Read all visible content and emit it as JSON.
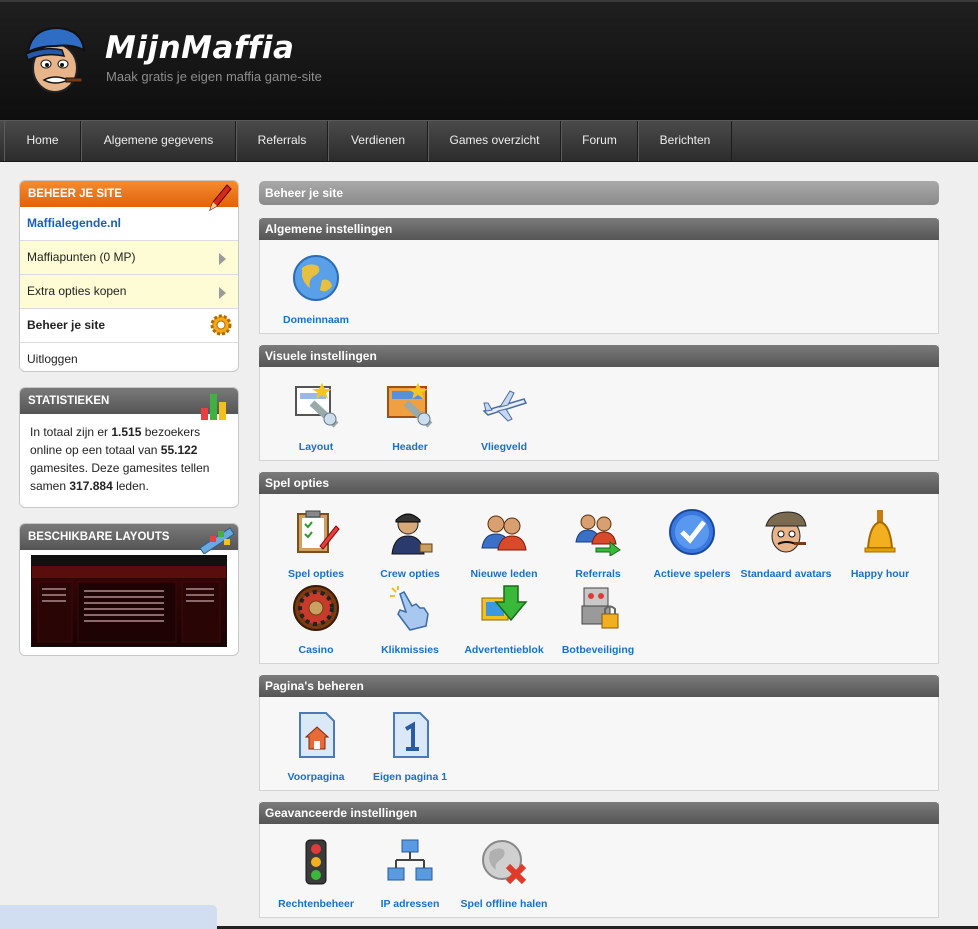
{
  "header": {
    "title": "MijnMaffia",
    "subtitle": "Maak gratis je eigen maffia game-site"
  },
  "nav": [
    "Home",
    "Algemene gegevens",
    "Referrals",
    "Verdienen",
    "Games overzicht",
    "Forum",
    "Berichten"
  ],
  "sidebar": {
    "manage": {
      "title": "BEHEER JE SITE",
      "site_link": "Maffialegende.nl",
      "items": [
        {
          "label": "Maffiapunten (0 MP)"
        },
        {
          "label": "Extra opties kopen"
        },
        {
          "label": "Beheer je site"
        },
        {
          "label": "Uitloggen"
        }
      ]
    },
    "stats": {
      "title": "STATISTIEKEN",
      "t1": "In totaal zijn er ",
      "visitors": "1.515",
      "t2": " bezoekers online op een totaal van ",
      "sites": "55.122",
      "t3": " gamesites. Deze gamesites tellen samen ",
      "members": "317.884",
      "t4": " leden."
    },
    "layouts": {
      "title": "BESCHIKBARE LAYOUTS"
    }
  },
  "main": {
    "title": "Beheer je site",
    "sections": [
      {
        "title": "Algemene instellingen",
        "items": [
          {
            "label": "Domeinnaam",
            "icon": "globe-icon"
          }
        ]
      },
      {
        "title": "Visuele instellingen",
        "items": [
          {
            "label": "Layout",
            "icon": "layout-icon"
          },
          {
            "label": "Header",
            "icon": "header-icon"
          },
          {
            "label": "Vliegveld",
            "icon": "airplane-icon"
          }
        ]
      },
      {
        "title": "Spel opties",
        "items": [
          {
            "label": "Spel opties",
            "icon": "clipboard-icon"
          },
          {
            "label": "Crew opties",
            "icon": "officer-icon"
          },
          {
            "label": "Nieuwe leden",
            "icon": "users-icon"
          },
          {
            "label": "Referrals",
            "icon": "users-arrow-icon"
          },
          {
            "label": "Actieve spelers",
            "icon": "checkmark-icon"
          },
          {
            "label": "Standaard avatars",
            "icon": "mobster-icon"
          },
          {
            "label": "Happy hour",
            "icon": "bell-icon"
          },
          {
            "label": "Casino",
            "icon": "roulette-icon"
          },
          {
            "label": "Klikmissies",
            "icon": "hand-click-icon"
          },
          {
            "label": "Advertentieblok",
            "icon": "advert-icon"
          },
          {
            "label": "Botbeveiliging",
            "icon": "robot-lock-icon"
          }
        ]
      },
      {
        "title": "Pagina's beheren",
        "items": [
          {
            "label": "Voorpagina",
            "icon": "home-page-icon"
          },
          {
            "label": "Eigen pagina 1",
            "icon": "page-one-icon"
          }
        ]
      },
      {
        "title": "Geavanceerde instellingen",
        "items": [
          {
            "label": "Rechtenbeheer",
            "icon": "traffic-light-icon"
          },
          {
            "label": "IP adressen",
            "icon": "network-icon"
          },
          {
            "label": "Spel offline halen",
            "icon": "globe-offline-icon"
          }
        ]
      }
    ]
  },
  "colors": {
    "accent_orange": "#e0630c",
    "link_blue": "#1a6fc9",
    "header_dark": "#141414",
    "section_gray": "#666666"
  }
}
